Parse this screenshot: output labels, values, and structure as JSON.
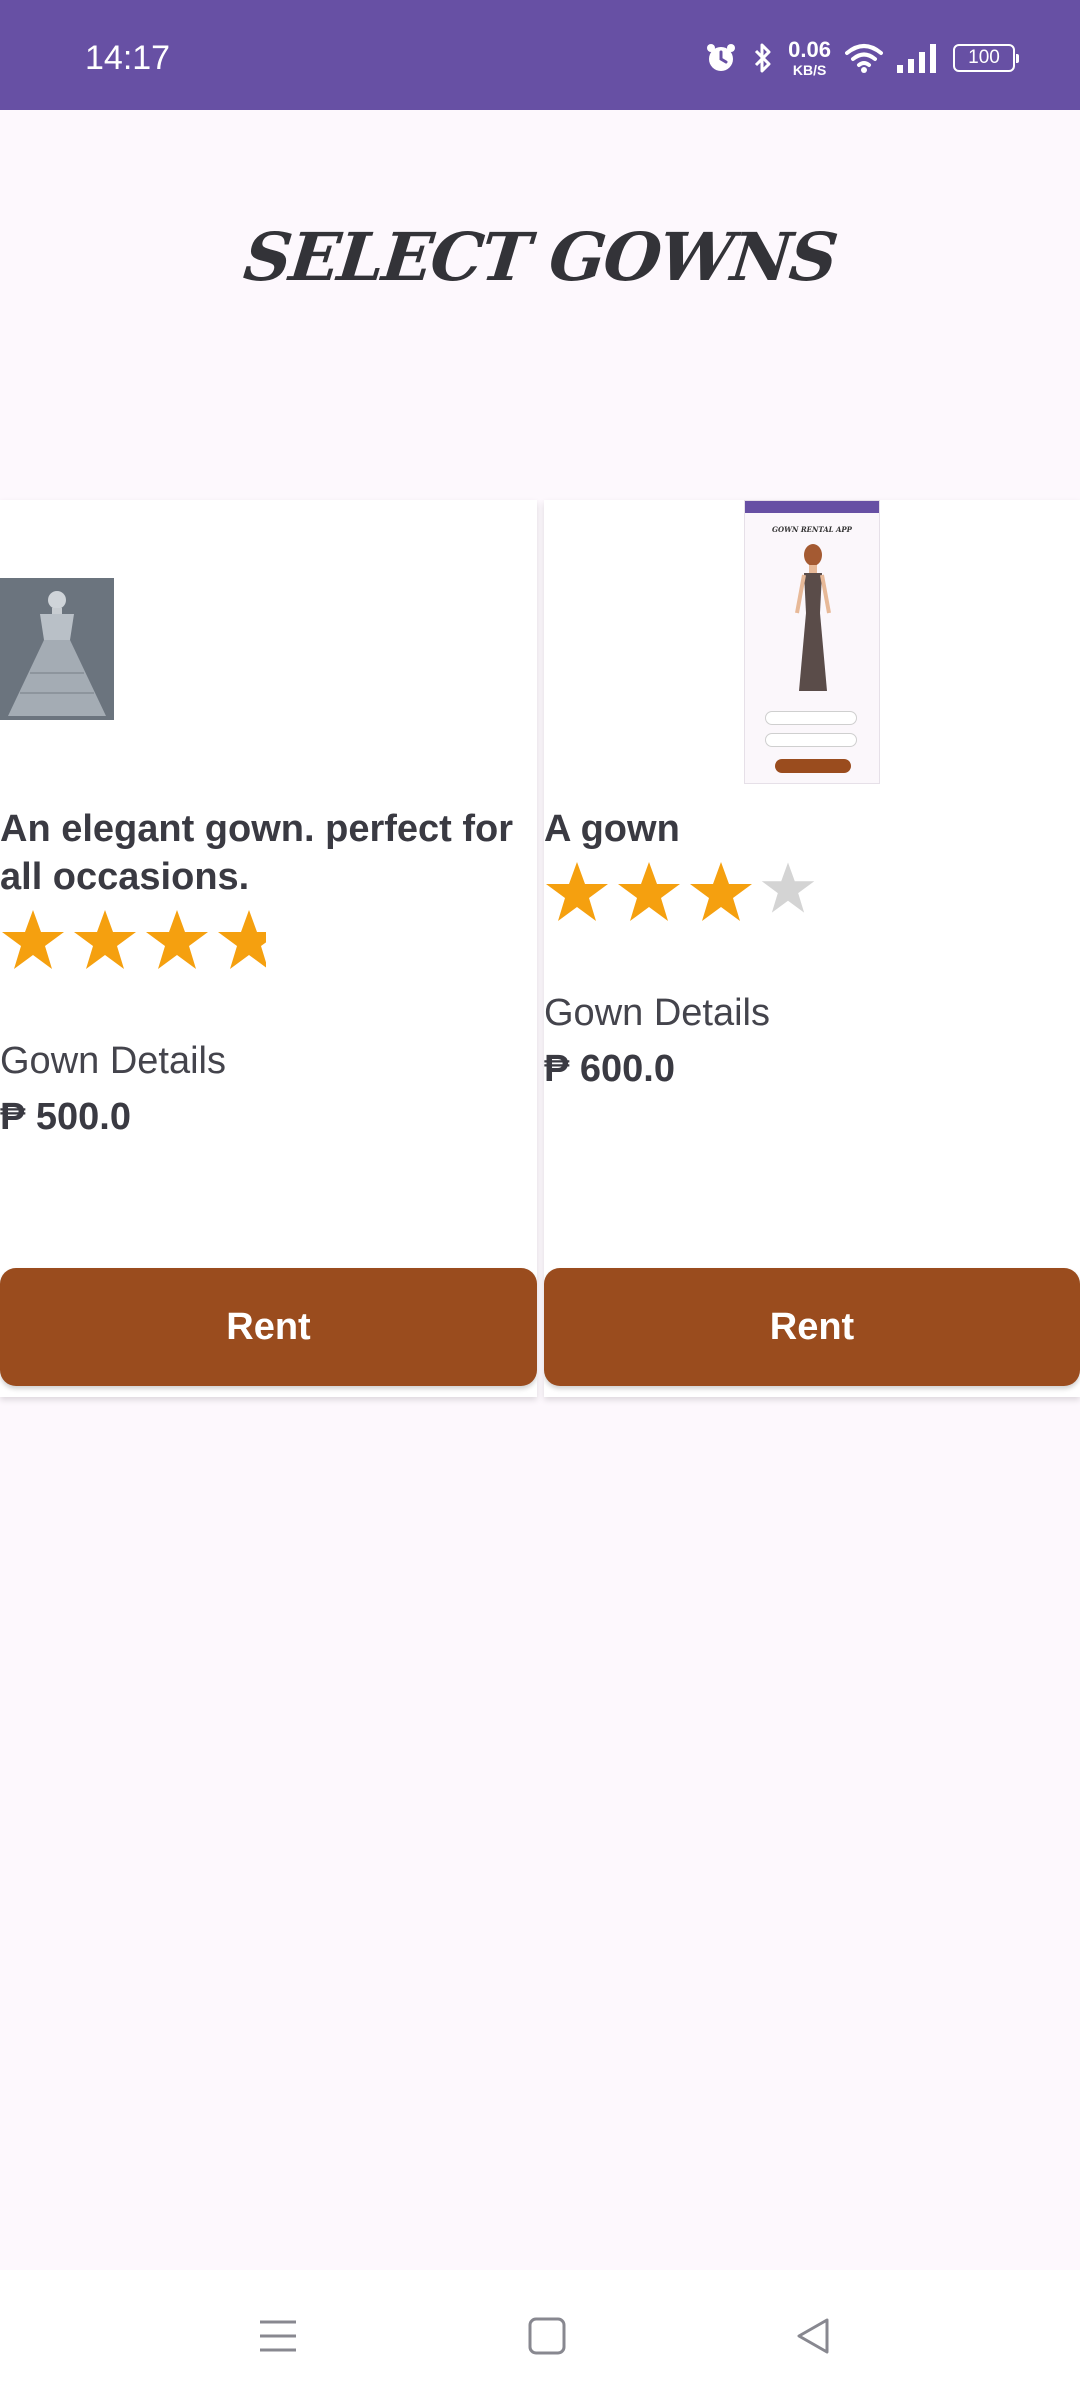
{
  "status_bar": {
    "time": "14:17",
    "net_speed_value": "0.06",
    "net_speed_unit": "KB/S",
    "battery": "100",
    "icons": [
      "alarm-icon",
      "bluetooth-icon",
      "wifi-icon",
      "signal-icon",
      "battery-icon"
    ]
  },
  "page": {
    "title": "SELECT GOWNS"
  },
  "gowns": [
    {
      "title": "An elegant gown. perfect for all occasions.",
      "rating": 4,
      "rating_max": 5,
      "details_label": "Gown Details",
      "price": "₱ 500.0",
      "rent_label": "Rent"
    },
    {
      "title": "A gown",
      "rating": 3,
      "rating_max": 4,
      "details_label": "Gown Details",
      "price": "₱ 600.0",
      "rent_label": "Rent",
      "thumbnail_title": "GOWN RENTAL APP"
    }
  ],
  "colors": {
    "status_bar": "#6750a4",
    "rent_button": "#9a4c1e",
    "star_filled": "#f5a00f",
    "star_empty": "#d4d4d4",
    "background": "#fdf8fd"
  },
  "nav_bar": {
    "icons": [
      "menu-icon",
      "home-icon",
      "back-icon"
    ]
  }
}
